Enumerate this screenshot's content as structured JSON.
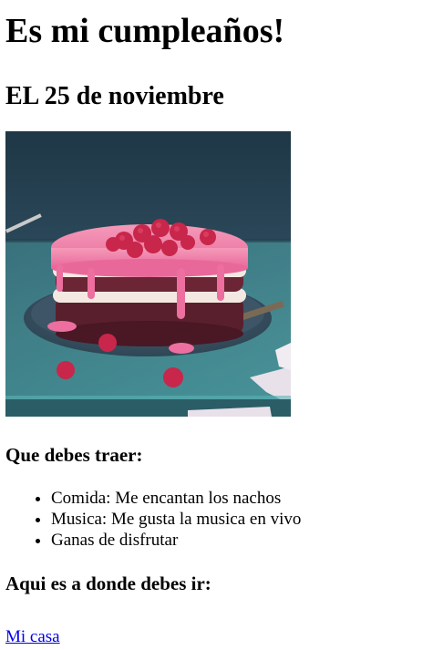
{
  "heading": {
    "title": "Es mi cumpleaños!",
    "date": "EL 25 de noviembre"
  },
  "image": {
    "subject": "raspberry layer cake with pink glaze",
    "colors": {
      "background": "#2c4a5c",
      "table": "#3f8c94",
      "plate": "#3d5566",
      "glaze": "#f07aa6",
      "sponge": "#5a1f2c",
      "cream": "#f3e9e2",
      "raspberry": "#c8264a"
    }
  },
  "bring": {
    "heading": "Que debes traer:",
    "items": [
      "Comida: Me encantan los nachos",
      "Musica: Me gusta la musica en vivo",
      "Ganas de disfrutar"
    ]
  },
  "where": {
    "heading": "Aqui es a donde debes ir:",
    "link_text": "Mi casa"
  }
}
